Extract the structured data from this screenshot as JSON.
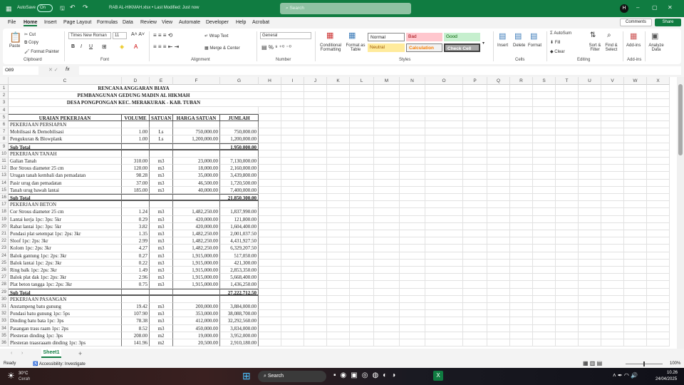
{
  "titlebar": {
    "autosave": "AutoSave",
    "toggle": "On",
    "filename": "RAB AL-HIKMAH.xlsx • Last Modified: Just now",
    "search_placeholder": "Search"
  },
  "menu": [
    "File",
    "Home",
    "Insert",
    "Page Layout",
    "Formulas",
    "Data",
    "Review",
    "View",
    "Automate",
    "Developer",
    "Help",
    "Acrobat"
  ],
  "actions": {
    "comments": "Comments",
    "share": "Share"
  },
  "ribbon": {
    "paste": "Paste",
    "cut": "Cut",
    "copy": "Copy",
    "format_painter": "Format Painter",
    "clipboard": "Clipboard",
    "font_name": "Times New Roman",
    "font_size": "11",
    "font": "Font",
    "wrap_text": "Wrap Text",
    "merge_center": "Merge & Center",
    "alignment": "Alignment",
    "number_format": "General",
    "number": "Number",
    "conditional": "Conditional Formatting",
    "format_table": "Format as Table",
    "styles_group": "Styles",
    "styles": [
      "Normal",
      "Bad",
      "Good",
      "Neutral",
      "Calculation",
      "Check Cell"
    ],
    "insert": "Insert",
    "delete": "Delete",
    "format": "Format",
    "cells": "Cells",
    "autosum": "AutoSum",
    "fill": "Fill",
    "clear": "Clear",
    "sort_filter": "Sort & Filter",
    "find_select": "Find & Select",
    "editing": "Editing",
    "addins": "Add-ins",
    "addins_group": "Add-ins",
    "analyze": "Analyze Data"
  },
  "formula_bar": {
    "name_box": "O89",
    "fx": "fx",
    "value": ""
  },
  "columns": [
    "C",
    "D",
    "E",
    "F",
    "G",
    "H",
    "I",
    "J",
    "K",
    "L",
    "M",
    "N",
    "O",
    "P",
    "Q",
    "R",
    "S",
    "T",
    "U",
    "V",
    "W",
    "X"
  ],
  "sheet": {
    "titles": [
      "RENCANA ANGGARAN BIAYA",
      "PEMBANGUNAN GEDUNG MADIN AL HIKMAH",
      "DESA PONGPONGAN KEC. MERAKURAK - KAB. TUBAN"
    ],
    "headers": [
      "URAIAN PEKERJAAN",
      "VOLUME",
      "SATUAN",
      "HARGA SATUAN",
      "JUMLAH"
    ],
    "rows": [
      {
        "n": 6,
        "type": "section",
        "desc": "PEKERJAAN PERSIAPAN"
      },
      {
        "n": 7,
        "desc": "Mobilisasi & Demobilisasi",
        "vol": "1.00",
        "sat": "Ls",
        "harga": "750,000.00",
        "jumlah": "750,000.00"
      },
      {
        "n": 8,
        "desc": "Pengukuran & Blowplank",
        "vol": "1.00",
        "sat": "Ls",
        "harga": "1,200,000.00",
        "jumlah": "1,200,000.00"
      },
      {
        "n": 9,
        "type": "subtotal",
        "desc": "Sub Total",
        "jumlah": "1,950,000.00"
      },
      {
        "n": 10,
        "type": "section",
        "desc": "PEKERJAAN TANAH"
      },
      {
        "n": 11,
        "desc": "Galian Tanah",
        "vol": "310.00",
        "sat": "m3",
        "harga": "23,000.00",
        "jumlah": "7,130,000.00"
      },
      {
        "n": 12,
        "desc": "Bor Strous diameter 25 cm",
        "vol": "120.00",
        "sat": "m3",
        "harga": "18,000.00",
        "jumlah": "2,160,000.00"
      },
      {
        "n": 13,
        "desc": "Urugan tanah kembali dan pemadatan",
        "vol": "98.28",
        "sat": "m3",
        "harga": "35,000.00",
        "jumlah": "3,439,800.00"
      },
      {
        "n": 14,
        "desc": "Pasir urug dan pemadatan",
        "vol": "37.00",
        "sat": "m3",
        "harga": "46,500.00",
        "jumlah": "1,720,500.00"
      },
      {
        "n": 15,
        "desc": "Tanah urug bawah lantai",
        "vol": "185.00",
        "sat": "m3",
        "harga": "40,000.00",
        "jumlah": "7,400,000.00"
      },
      {
        "n": 16,
        "type": "subtotal",
        "desc": "Sub Total",
        "jumlah": "21,850,300.00"
      },
      {
        "n": 17,
        "type": "section",
        "desc": "PEKERJAAN BETON"
      },
      {
        "n": 18,
        "desc": "Cor Strous diameter 25 cm",
        "vol": "1.24",
        "sat": "m3",
        "harga": "1,482,250.00",
        "jumlah": "1,837,990.00"
      },
      {
        "n": 19,
        "desc": "Lantai kerja 1pc: 3ps: 5kr",
        "vol": "0.29",
        "sat": "m3",
        "harga": "420,000.00",
        "jumlah": "121,800.00"
      },
      {
        "n": 20,
        "desc": "Rabat lantai 1pc: 3ps: 5kr",
        "vol": "3.82",
        "sat": "m3",
        "harga": "420,000.00",
        "jumlah": "1,604,400.00"
      },
      {
        "n": 21,
        "desc": "Pondasi plat setempat 1pc: 2ps: 3kr",
        "vol": "1.35",
        "sat": "m3",
        "harga": "1,482,250.00",
        "jumlah": "2,001,037.50"
      },
      {
        "n": 22,
        "desc": "Sloof 1pc: 2ps: 3kr",
        "vol": "2.99",
        "sat": "m3",
        "harga": "1,482,250.00",
        "jumlah": "4,431,927.50"
      },
      {
        "n": 23,
        "desc": "Kolom 1pc: 2ps: 3kr",
        "vol": "4.27",
        "sat": "m3",
        "harga": "1,482,250.00",
        "jumlah": "6,329,207.50"
      },
      {
        "n": 24,
        "desc": "Balok gantung  1pc: 2ps: 3kr",
        "vol": "0.27",
        "sat": "m3",
        "harga": "1,915,000.00",
        "jumlah": "517,050.00"
      },
      {
        "n": 25,
        "desc": "Balok lantai  1pc: 2ps: 3kr",
        "vol": "0.22",
        "sat": "m3",
        "harga": "1,915,000.00",
        "jumlah": "421,300.00"
      },
      {
        "n": 26,
        "desc": "Ring balk  1pc: 2ps: 3kr",
        "vol": "1.49",
        "sat": "m3",
        "harga": "1,915,000.00",
        "jumlah": "2,853,350.00"
      },
      {
        "n": 27,
        "desc": "Balok plat dak  1pc: 2ps: 3kr",
        "vol": "2.96",
        "sat": "m3",
        "harga": "1,915,000.00",
        "jumlah": "5,668,400.00"
      },
      {
        "n": 28,
        "desc": "Plat beton tangga 1pc: 2ps: 3kr",
        "vol": "0.75",
        "sat": "m3",
        "harga": "1,915,000.00",
        "jumlah": "1,436,250.00"
      },
      {
        "n": 29,
        "type": "subtotal",
        "desc": "Sub Total",
        "jumlah": "27,222,712.50"
      },
      {
        "n": 30,
        "type": "section",
        "desc": "PEKERJAAN PASANGAN"
      },
      {
        "n": 31,
        "desc": "Anstampeng batu gunung",
        "vol": "19.42",
        "sat": "m3",
        "harga": "200,000.00",
        "jumlah": "3,884,000.00"
      },
      {
        "n": 32,
        "desc": "Pondasi batu gunung 1pc: 5ps",
        "vol": "107.90",
        "sat": "m3",
        "harga": "353,000.00",
        "jumlah": "38,088,700.00"
      },
      {
        "n": 33,
        "desc": "Dinding batu bata 1pc: 3ps",
        "vol": "78.38",
        "sat": "m3",
        "harga": "412,000.00",
        "jumlah": "32,292,560.00"
      },
      {
        "n": 34,
        "desc": "Pasangan trass raam 1pc: 2ps",
        "vol": "8.52",
        "sat": "m3",
        "harga": "450,000.00",
        "jumlah": "3,834,000.00"
      },
      {
        "n": 35,
        "desc": "Plesteran dinding 1pc: 3ps",
        "vol": "208.00",
        "sat": "m2",
        "harga": "19,000.00",
        "jumlah": "3,952,000.00"
      },
      {
        "n": 36,
        "desc": "Plesteran traasraaam dinding 1pc: 3ps",
        "vol": "141.96",
        "sat": "m2",
        "harga": "20,500.00",
        "jumlah": "2,910,180.00"
      }
    ]
  },
  "tabs": {
    "sheet": "Sheet1",
    "add": "+"
  },
  "status": {
    "ready": "Ready",
    "accessibility": "Accessibility: Investigate",
    "zoom": "100%"
  },
  "taskbar": {
    "temp": "30°C",
    "weather": "Cerah",
    "search": "Search",
    "time": "10.26",
    "date": "24/04/2025"
  }
}
